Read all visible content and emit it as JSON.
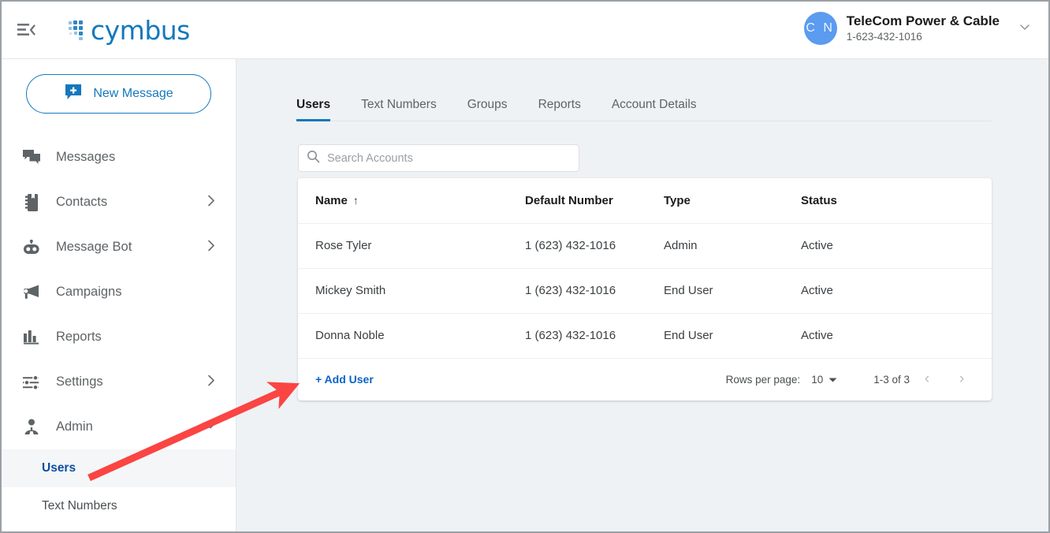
{
  "header": {
    "menu_icon": "menu-collapse-icon",
    "logo_text": "cymbus",
    "logo_color": "#1478bd",
    "account": {
      "avatar_initials": "C N",
      "avatar_color": "#5b9bf0",
      "name": "TeleCom Power & Cable",
      "phone": "1-623-432-1016",
      "caret_icon": "chevron-down-icon"
    }
  },
  "sidebar": {
    "new_message_label": "New Message",
    "new_message_icon": "new-message-plus-icon",
    "items": [
      {
        "label": "Messages",
        "icon": "messages-icon",
        "chevron": ""
      },
      {
        "label": "Contacts",
        "icon": "contacts-icon",
        "chevron": "›"
      },
      {
        "label": "Message Bot",
        "icon": "message-bot-icon",
        "chevron": "›"
      },
      {
        "label": "Campaigns",
        "icon": "campaigns-icon",
        "chevron": ""
      },
      {
        "label": "Reports",
        "icon": "reports-icon",
        "chevron": ""
      },
      {
        "label": "Settings",
        "icon": "settings-icon",
        "chevron": "›"
      },
      {
        "label": "Admin",
        "icon": "admin-icon",
        "chevron": "⌄"
      }
    ],
    "sub_items": [
      {
        "label": "Users",
        "active": true
      },
      {
        "label": "Text Numbers",
        "active": false
      }
    ]
  },
  "main": {
    "tabs": [
      {
        "label": "Users",
        "active": true
      },
      {
        "label": "Text Numbers",
        "active": false
      },
      {
        "label": "Groups",
        "active": false
      },
      {
        "label": "Reports",
        "active": false
      },
      {
        "label": "Account Details",
        "active": false
      }
    ],
    "search": {
      "placeholder": "Search Accounts",
      "value": "",
      "icon": "search-icon"
    },
    "table": {
      "columns": [
        "Name",
        "Default Number",
        "Type",
        "Status"
      ],
      "sort_column": "Name",
      "sort_icon": "↑",
      "rows": [
        {
          "name": "Rose Tyler",
          "number": "1 (623) 432-1016",
          "type": "Admin",
          "status": "Active"
        },
        {
          "name": "Mickey Smith",
          "number": "1 (623) 432-1016",
          "type": "End User",
          "status": "Active"
        },
        {
          "name": "Donna Noble",
          "number": "1 (623) 432-1016",
          "type": "End User",
          "status": "Active"
        }
      ]
    },
    "footer": {
      "add_user_label": "+ Add User",
      "rows_per_page_label": "Rows per page:",
      "rows_per_page_value": "10",
      "rows_per_page_caret": "▾",
      "range_label": "1-3 of 3",
      "prev_icon": "chevron-left-icon",
      "next_icon": "chevron-right-icon",
      "prev_glyph": "‹",
      "next_glyph": "›"
    }
  },
  "annotation": {
    "type": "arrow",
    "color": "#fa4543",
    "points": "from (110,603) to (376,484)"
  }
}
